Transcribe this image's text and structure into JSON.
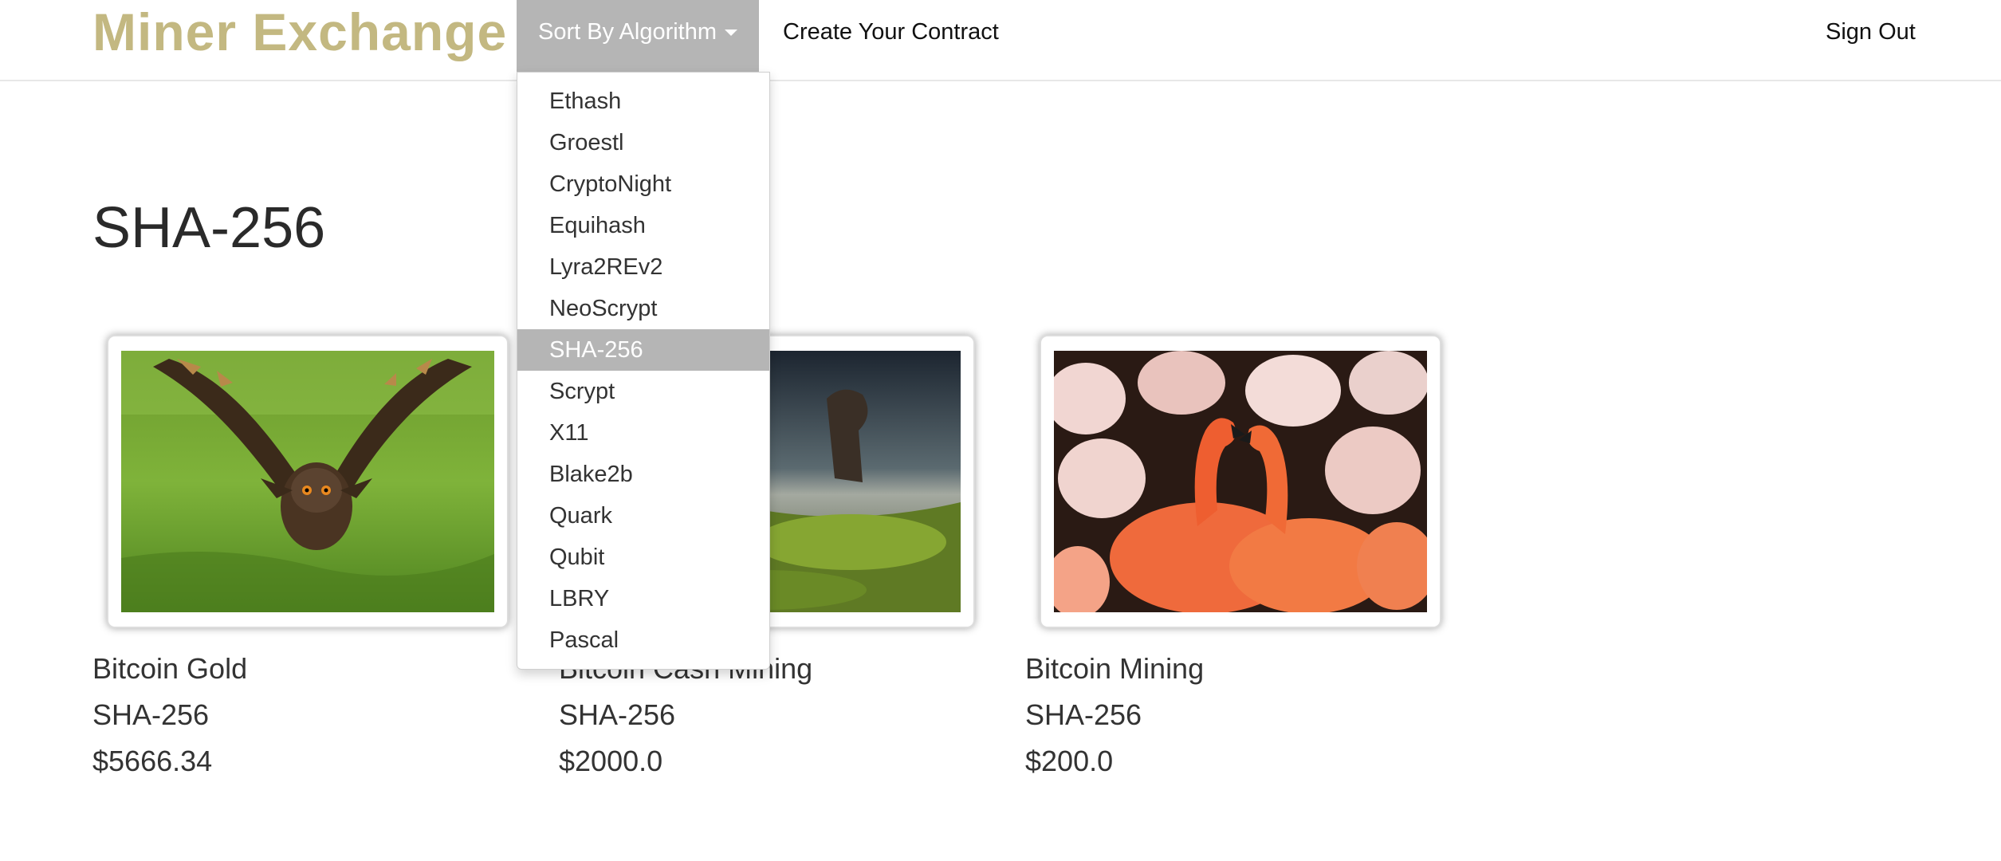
{
  "navbar": {
    "brand": "Miner Exchange",
    "sort_label": "Sort By Algorithm",
    "create_label": "Create Your Contract",
    "signout_label": "Sign Out"
  },
  "dropdown": {
    "items": [
      "Ethash",
      "Groestl",
      "CryptoNight",
      "Equihash",
      "Lyra2REv2",
      "NeoScrypt",
      "SHA-256",
      "Scrypt",
      "X11",
      "Blake2b",
      "Quark",
      "Qubit",
      "LBRY",
      "Pascal"
    ],
    "active": "SHA-256"
  },
  "page": {
    "title": "SHA-256"
  },
  "cards": [
    {
      "name": "Bitcoin Gold",
      "algorithm": "SHA-256",
      "price": "$5666.34",
      "image": "owl-photo"
    },
    {
      "name": "Bitcoin Cash Mining",
      "algorithm": "SHA-256",
      "price": "$2000.0",
      "image": "coastal-rock-photo"
    },
    {
      "name": "Bitcoin Mining",
      "algorithm": "SHA-256",
      "price": "$200.0",
      "image": "flamingos-photo"
    }
  ],
  "colors": {
    "brand": "#c3b881",
    "nav_active": "#b5b5b5"
  }
}
